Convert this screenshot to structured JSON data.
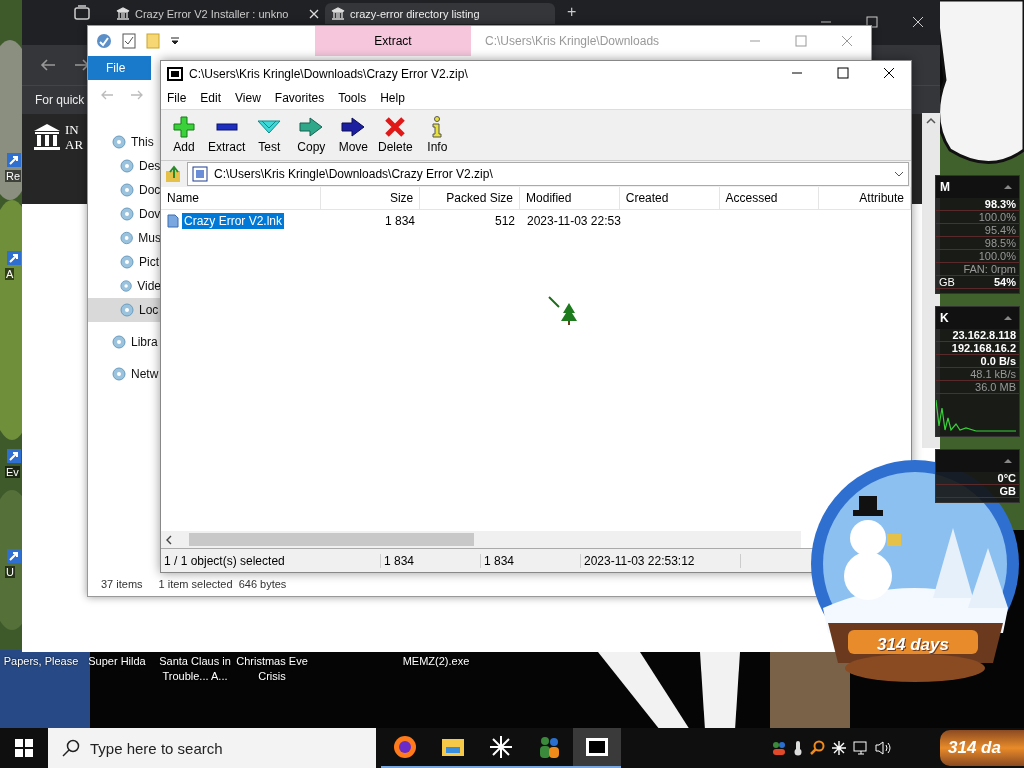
{
  "desktop": {
    "left_icons": [
      {
        "label": "Re"
      },
      {
        "label": "A"
      },
      {
        "label": "Ev"
      },
      {
        "label": "U"
      }
    ],
    "bottom_icons": [
      {
        "label": "Papers, Please"
      },
      {
        "label": "Super Hilda"
      },
      {
        "label": "Santa Claus in Trouble... A..."
      },
      {
        "label": "Christmas Eve Crisis"
      },
      {
        "label": "MEMZ(2).exe"
      }
    ]
  },
  "browser": {
    "tabs": [
      {
        "title": "Crazy Error V2 Installer : unkno",
        "selected": false
      },
      {
        "title": "crazy-error directory listing",
        "selected": true
      }
    ],
    "new_tab": "+",
    "bookmark_text": "For quick",
    "site_logo": [
      "IN",
      "AR"
    ]
  },
  "explorer": {
    "ribbon_tabs": [
      {
        "label": "File",
        "kind": "file"
      },
      {
        "label": "Extract",
        "kind": "contextual"
      }
    ],
    "title": "C:\\Users\\Kris Kringle\\Downloads",
    "nav": [
      {
        "label": "This",
        "selected": false,
        "children": [
          {
            "label": "Des",
            "selected": false
          },
          {
            "label": "Doc",
            "selected": false
          },
          {
            "label": "Dov",
            "selected": false
          },
          {
            "label": "Mus",
            "selected": false
          },
          {
            "label": "Pict",
            "selected": false
          },
          {
            "label": "Vide",
            "selected": false
          },
          {
            "label": "Loc",
            "selected": true
          }
        ]
      },
      {
        "label": "Libra",
        "selected": false
      },
      {
        "label": "Netw",
        "selected": false
      }
    ],
    "status": [
      "37 items",
      "1 item selected  646 bytes"
    ]
  },
  "archiver": {
    "title": "C:\\Users\\Kris Kringle\\Downloads\\Crazy Error V2.zip\\",
    "menu": [
      "File",
      "Edit",
      "View",
      "Favorites",
      "Tools",
      "Help"
    ],
    "toolbar": [
      {
        "label": "Add",
        "kind": "add"
      },
      {
        "label": "Extract",
        "kind": "extract"
      },
      {
        "label": "Test",
        "kind": "test"
      },
      {
        "label": "Copy",
        "kind": "copy"
      },
      {
        "label": "Move",
        "kind": "move"
      },
      {
        "label": "Delete",
        "kind": "delete"
      },
      {
        "label": "Info",
        "kind": "info"
      }
    ],
    "address": "C:\\Users\\Kris Kringle\\Downloads\\Crazy Error V2.zip\\",
    "columns": [
      {
        "label": "Name"
      },
      {
        "label": "Size"
      },
      {
        "label": "Packed Size"
      },
      {
        "label": "Modified"
      },
      {
        "label": "Created"
      },
      {
        "label": "Accessed"
      },
      {
        "label": "Attribute"
      }
    ],
    "rows": [
      {
        "cells": [
          "Crazy Error V2.lnk",
          "1 834",
          "512",
          "2023-11-03 22:53"
        ],
        "selected": true
      }
    ],
    "status": [
      "1 / 1 object(s) selected",
      "1 834",
      "1 834",
      "2023-11-03 22:53:12"
    ]
  },
  "monitor": {
    "sections": [
      {
        "title": "M",
        "rows": [
          {
            "value": "98.3%",
            "dim": false
          },
          {
            "value": "100.0%",
            "dim": true
          },
          {
            "value": "95.4%",
            "dim": true
          },
          {
            "value": "98.5%",
            "dim": true
          },
          {
            "value": "100.0%",
            "dim": true
          },
          {
            "value": "FAN: 0rpm",
            "dim": true
          },
          {
            "label": "GB",
            "value": "54%",
            "dim": false
          }
        ]
      },
      {
        "title": "K",
        "rows": [
          {
            "value": "23.162.8.118",
            "dim": false
          },
          {
            "value": "192.168.16.2",
            "dim": false
          },
          {
            "value": "0.0 B/s",
            "dim": false
          },
          {
            "value": "48.1 kB/s",
            "dim": true
          },
          {
            "value": "36.0 MB",
            "dim": true
          }
        ]
      },
      {
        "rows": [
          {
            "value": "0°C",
            "dim": false
          },
          {
            "value": "GB",
            "dim": false
          }
        ]
      }
    ]
  },
  "globe": {
    "counter": "314 days"
  },
  "taskbar": {
    "search_placeholder": "Type here to search",
    "apps": [
      {
        "kind": "firefox",
        "active": false
      },
      {
        "kind": "folder",
        "active": false
      },
      {
        "kind": "asterisk",
        "active": false
      },
      {
        "kind": "people",
        "active": false
      },
      {
        "kind": "archive",
        "active": true
      }
    ],
    "tray_counter": "314 da"
  }
}
